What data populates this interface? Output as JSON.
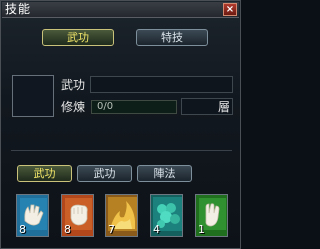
{
  "window": {
    "title": "技能",
    "close_label": "×"
  },
  "top_tabs": [
    {
      "label": "武功",
      "active": true
    },
    {
      "label": "特技",
      "active": false
    }
  ],
  "info": {
    "skill_label": "武功",
    "skill_value": "",
    "cultivation_label": "修煉",
    "progress_text": "0/0",
    "progress_fraction": 0,
    "level_label": "層"
  },
  "bottom_tabs": [
    {
      "label": "武功",
      "active": true
    },
    {
      "label": "武功",
      "active": false
    },
    {
      "label": "陣法",
      "active": false
    }
  ],
  "slots": [
    {
      "icon": "palm-icon",
      "count": "8",
      "color": "#1f6f9a"
    },
    {
      "icon": "fist-icon",
      "count": "8",
      "color": "#b3471c"
    },
    {
      "icon": "flame-icon",
      "count": "7",
      "color": "#c89128"
    },
    {
      "icon": "cloud-icon",
      "count": "4",
      "color": "#1f8f8a"
    },
    {
      "icon": "hand-icon",
      "count": "1",
      "color": "#2d8f2d"
    }
  ]
}
